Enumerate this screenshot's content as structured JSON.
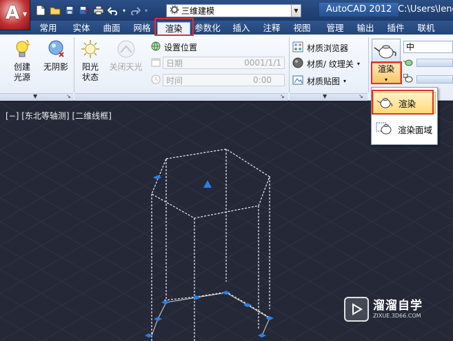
{
  "titlebar": {
    "app_title": "AutoCAD 2012",
    "file_path": "C:\\Users\\leno",
    "workspace": "三维建模"
  },
  "tabs": [
    {
      "label": "常用"
    },
    {
      "label": "实体"
    },
    {
      "label": "曲面"
    },
    {
      "label": "网格"
    },
    {
      "label": "渲染",
      "active": true
    },
    {
      "label": "参数化"
    },
    {
      "label": "插入"
    },
    {
      "label": "注释"
    },
    {
      "label": "视图"
    },
    {
      "label": "管理"
    },
    {
      "label": "输出"
    },
    {
      "label": "插件"
    },
    {
      "label": "联机"
    }
  ],
  "ribbon": {
    "lights": {
      "create_light": "创建\n光源",
      "no_shadow": "无阴影"
    },
    "sun": {
      "sun_status": "阳光\n状态",
      "sky_off": "关闭天光",
      "set_location": "设置位置",
      "date_label": "日期",
      "date_value": "0001/1/1",
      "time_label": "时间",
      "time_value": "0:00"
    },
    "materials": {
      "browser": "材质浏览器",
      "texture": "材质/ 纹理关",
      "mapping": "材质贴图"
    },
    "render": {
      "label": "渲染",
      "quality": "中"
    }
  },
  "render_menu": [
    {
      "label": "渲染",
      "selected": true
    },
    {
      "label": "渲染面域",
      "selected": false
    }
  ],
  "viewport": {
    "controls": "[−]",
    "view": "[东北等轴测]",
    "style": "[二维线框]"
  },
  "watermark": {
    "title": "溜溜自学",
    "url": "ZIXUE.3D66.COM"
  },
  "colors": {
    "highlight": "#e03030",
    "grip": "#2a7fe6",
    "viewport_bg": "#242837"
  }
}
